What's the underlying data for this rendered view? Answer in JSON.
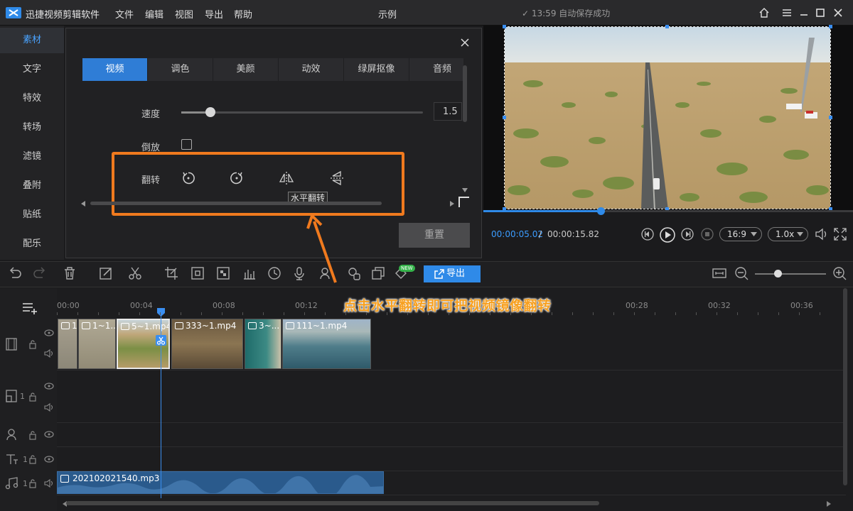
{
  "app": {
    "name": "迅捷视频剪辑软件",
    "project": "示例",
    "autosave": "✓ 13:59 自动保存成功"
  },
  "menu": [
    "文件",
    "编辑",
    "视图",
    "导出",
    "帮助"
  ],
  "sidebar": {
    "items": [
      {
        "label": "素材",
        "active": true
      },
      {
        "label": "文字"
      },
      {
        "label": "特效"
      },
      {
        "label": "转场"
      },
      {
        "label": "滤镜"
      },
      {
        "label": "叠附"
      },
      {
        "label": "贴纸"
      },
      {
        "label": "配乐"
      }
    ]
  },
  "panel": {
    "tabs": [
      "视频",
      "调色",
      "美颜",
      "动效",
      "绿屏抠像",
      "音频"
    ],
    "speed_label": "速度",
    "speed_value": "1.5",
    "speed_fraction": 0.12,
    "reverse_label": "倒放",
    "flip_label": "翻转",
    "tooltip": "水平翻转",
    "reset_label": "重置"
  },
  "player": {
    "current_time": "00:00:05.02",
    "separator": "/",
    "total_time": "00:00:15.82",
    "progress_fraction": 0.318,
    "aspect": "16:9",
    "speed": "1.0x"
  },
  "toolbar": {
    "export_label": "导出",
    "new_badge": "NEW"
  },
  "timeline": {
    "ticks": [
      "00:00",
      "00:04",
      "00:08",
      "00:12",
      "00:28",
      "00:32",
      "00:36"
    ],
    "annotation": "点击水平翻转即可把视频镜像翻转",
    "clips": [
      {
        "label": "1"
      },
      {
        "label": "1~1..."
      },
      {
        "label": "5~1.mp4"
      },
      {
        "label": "333~1.mp4"
      },
      {
        "label": "3~..."
      },
      {
        "label": "111~1.mp4"
      }
    ],
    "audio_clip": "202102021540.mp3",
    "track_numbers": [
      "1",
      "1",
      "1"
    ]
  },
  "colors": {
    "accent": "#2f8ae8",
    "highlight": "#f07a1e",
    "annotation": "#f7a020"
  }
}
